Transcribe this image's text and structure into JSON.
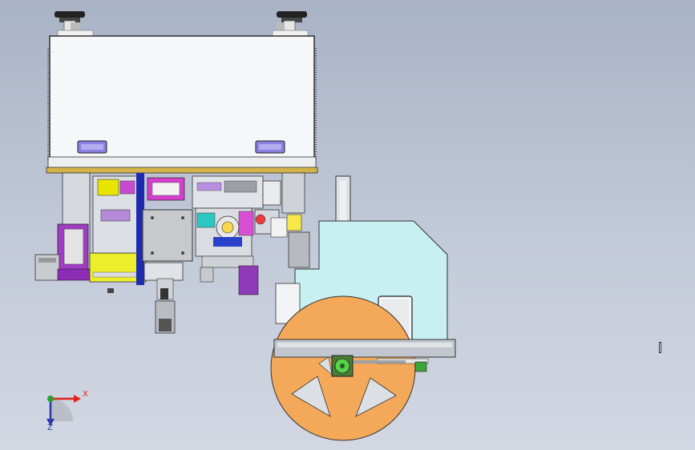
{
  "viewport": {
    "background_top": "#a9b3c6",
    "background_bottom": "#d2d7e2"
  },
  "triad": {
    "x_label": "X",
    "y_label": "Z",
    "x_color": "#e0241c",
    "y_color": "#2b3aa8",
    "origin_color": "#2ca02c"
  },
  "model": {
    "cabinet_color": "#f4f5f7",
    "handle_color": "#8c7ee0",
    "mount_color": "#d4b34a",
    "reel_color": "#f4a85a",
    "guard_color": "#c8f0f2",
    "frame_color": "#c2c7cf"
  }
}
